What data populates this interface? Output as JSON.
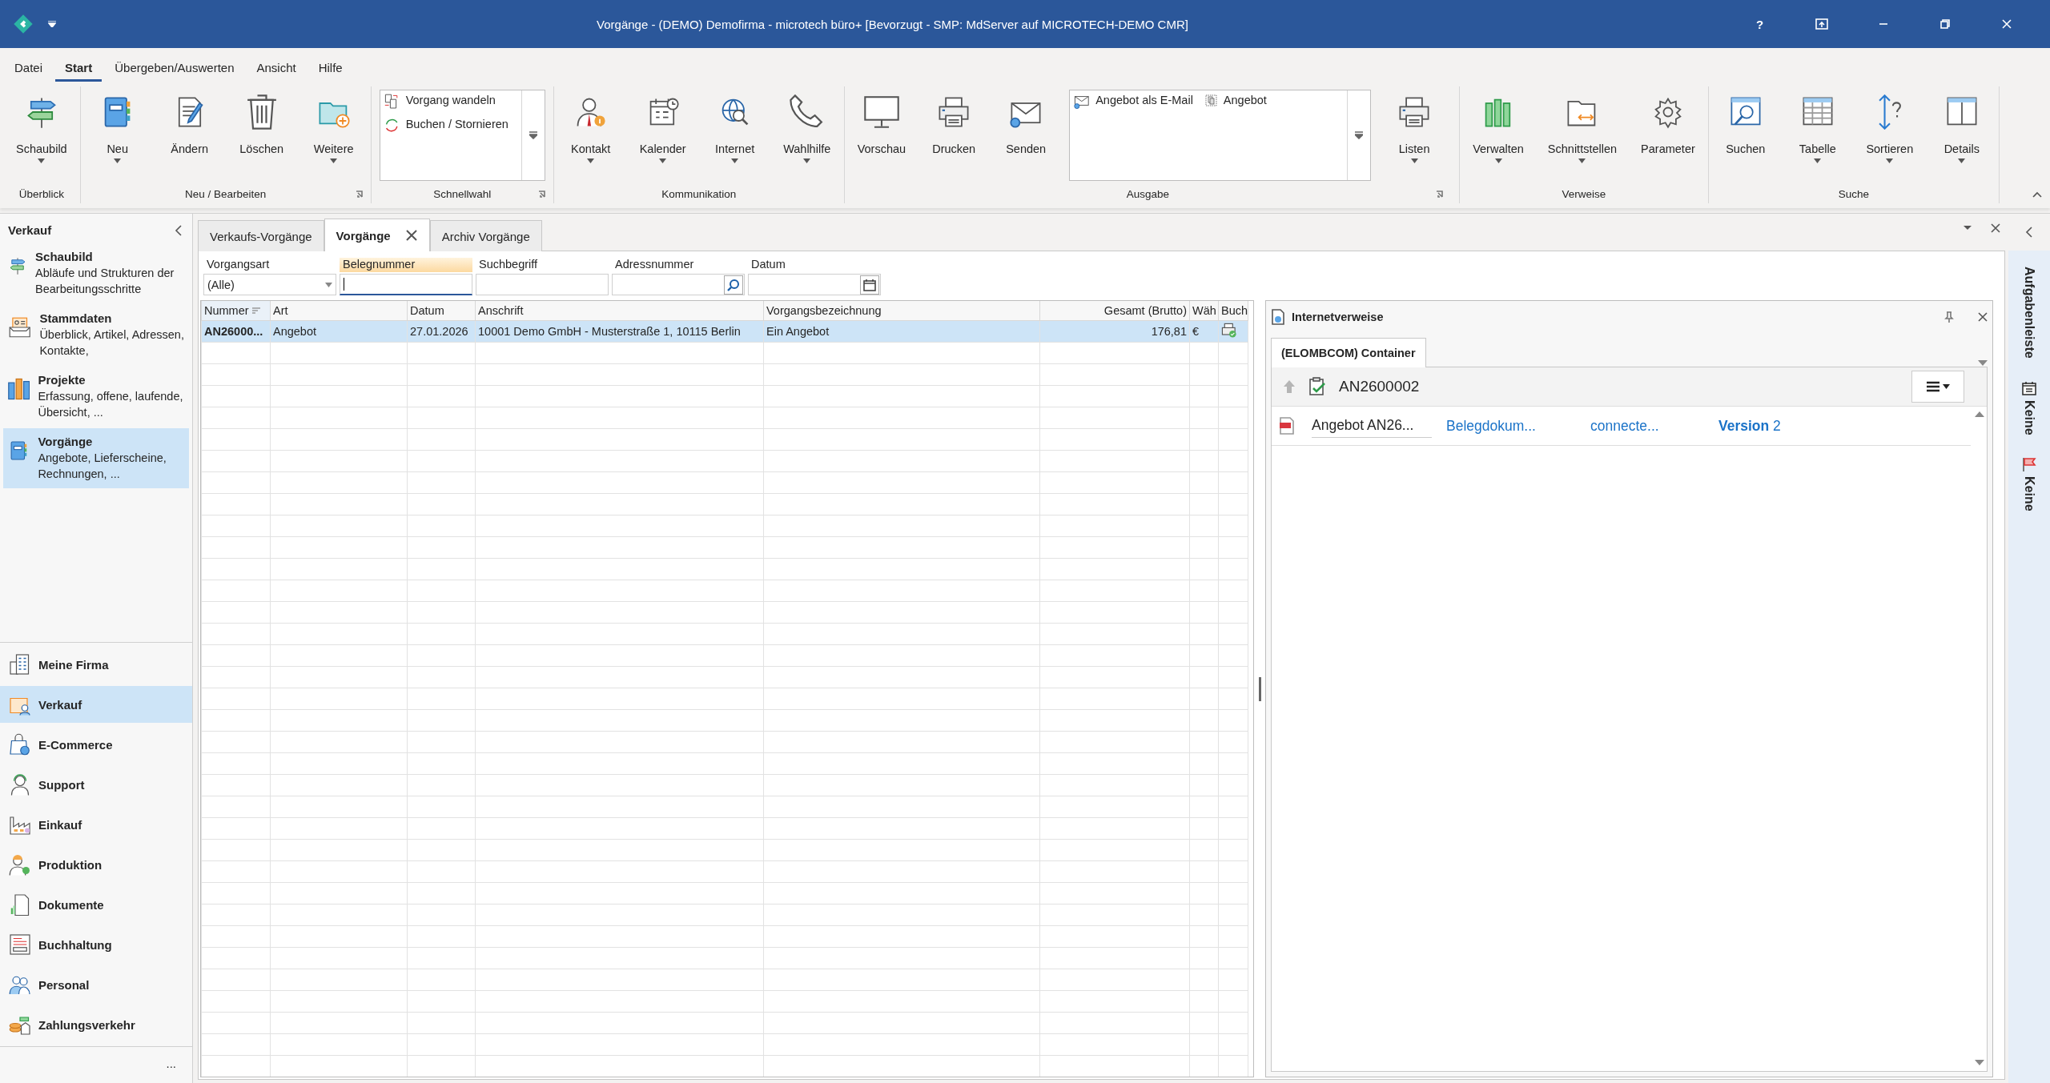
{
  "window": {
    "title": "Vorgänge - (DEMO) Demofirma - microtech büro+ [Bevorzugt - SMP: MdServer auf MICROTECH-DEMO CMR]",
    "help": "?"
  },
  "menu_tabs": [
    {
      "label": "Datei",
      "selected": false
    },
    {
      "label": "Start",
      "selected": true
    },
    {
      "label": "Übergeben/Auswerten",
      "selected": false
    },
    {
      "label": "Ansicht",
      "selected": false
    },
    {
      "label": "Hilfe",
      "selected": false
    }
  ],
  "ribbon": {
    "groups": [
      {
        "label": "Überblick",
        "launcher": false,
        "items": [
          {
            "kind": "large",
            "label": "Schaubild",
            "dropdown": true
          }
        ]
      },
      {
        "label": "Neu / Bearbeiten",
        "launcher": true,
        "items": [
          {
            "kind": "large",
            "label": "Neu",
            "dropdown": true
          },
          {
            "kind": "large",
            "label": "Ändern",
            "dropdown": false
          },
          {
            "kind": "large",
            "label": "Löschen",
            "dropdown": false
          },
          {
            "kind": "large",
            "label": "Weitere",
            "dropdown": true
          }
        ]
      },
      {
        "label": "Schnellwahl",
        "launcher": true,
        "items": [
          {
            "kind": "gallery",
            "entries": [
              "Vorgang wandeln",
              "Buchen / Stornieren"
            ]
          }
        ]
      },
      {
        "label": "Kommunikation",
        "launcher": false,
        "items": [
          {
            "kind": "large",
            "label": "Kontakt",
            "dropdown": true
          },
          {
            "kind": "large",
            "label": "Kalender",
            "dropdown": true
          },
          {
            "kind": "large",
            "label": "Internet",
            "dropdown": true
          },
          {
            "kind": "large",
            "label": "Wahlhilfe",
            "dropdown": true
          }
        ]
      },
      {
        "label": "Ausgabe",
        "launcher": true,
        "items": [
          {
            "kind": "large",
            "label": "Vorschau",
            "dropdown": false
          },
          {
            "kind": "large",
            "label": "Drucken",
            "dropdown": false
          },
          {
            "kind": "large",
            "label": "Senden",
            "dropdown": false
          },
          {
            "kind": "gallery",
            "entries": [
              "Angebot als E-Mail",
              "Angebot"
            ]
          },
          {
            "kind": "large",
            "label": "Listen",
            "dropdown": true
          }
        ]
      },
      {
        "label": "Verweise",
        "launcher": false,
        "items": [
          {
            "kind": "large",
            "label": "Verwalten",
            "dropdown": true
          },
          {
            "kind": "large",
            "label": "Schnittstellen",
            "dropdown": true
          },
          {
            "kind": "large",
            "label": "Parameter",
            "dropdown": false
          }
        ]
      },
      {
        "label": "Suche",
        "launcher": false,
        "items": [
          {
            "kind": "large",
            "label": "Suchen",
            "dropdown": false
          },
          {
            "kind": "large",
            "label": "Tabelle",
            "dropdown": true
          },
          {
            "kind": "large",
            "label": "Sortieren",
            "dropdown": true
          },
          {
            "kind": "large",
            "label": "Details",
            "dropdown": true
          }
        ]
      }
    ]
  },
  "sidebar": {
    "title": "Verkauf",
    "modules": [
      {
        "title": "Schaubild",
        "description": "Abläufe und Strukturen der Bearbeitungsschritte",
        "selected": false
      },
      {
        "title": "Stammdaten",
        "description": "Überblick, Artikel, Adressen, Kontakte,",
        "selected": false
      },
      {
        "title": "Projekte",
        "description": "Erfassung, offene, laufende, Übersicht, ...",
        "selected": false
      },
      {
        "title": "Vorgänge",
        "description": "Angebote, Lieferscheine, Rechnungen, ...",
        "selected": true
      }
    ],
    "sections": [
      {
        "label": "Meine Firma",
        "selected": false
      },
      {
        "label": "Verkauf",
        "selected": true
      },
      {
        "label": "E-Commerce",
        "selected": false
      },
      {
        "label": "Support",
        "selected": false
      },
      {
        "label": "Einkauf",
        "selected": false
      },
      {
        "label": "Produktion",
        "selected": false
      },
      {
        "label": "Dokumente",
        "selected": false
      },
      {
        "label": "Buchhaltung",
        "selected": false
      },
      {
        "label": "Personal",
        "selected": false
      },
      {
        "label": "Zahlungsverkehr",
        "selected": false
      }
    ],
    "more": "..."
  },
  "doc_tabs": [
    {
      "label": "Verkaufs-Vorgänge",
      "selected": false,
      "closable": false
    },
    {
      "label": "Vorgänge",
      "selected": true,
      "closable": true
    },
    {
      "label": "Archiv Vorgänge",
      "selected": false,
      "closable": false
    }
  ],
  "filters": [
    {
      "kind": "select",
      "label": "Vorgangsart",
      "value": "(Alle)",
      "focused": false
    },
    {
      "kind": "text",
      "label": "Belegnummer",
      "focused": true
    },
    {
      "kind": "text",
      "label": "Suchbegriff",
      "focused": false
    },
    {
      "kind": "search",
      "label": "Adressnummer",
      "focused": false
    },
    {
      "kind": "date",
      "label": "Datum",
      "focused": false
    }
  ],
  "table": {
    "columns": [
      {
        "label": "Nummer",
        "sorted": true
      },
      {
        "label": "Art",
        "sorted": false
      },
      {
        "label": "Datum",
        "sorted": false
      },
      {
        "label": "Anschrift",
        "sorted": false
      },
      {
        "label": "Vorgangsbezeichnung",
        "sorted": false
      },
      {
        "label": "Gesamt (Brutto)",
        "sorted": false
      },
      {
        "label": "Wäh",
        "sorted": false
      },
      {
        "label": "Buch",
        "sorted": false
      }
    ],
    "rows": [
      {
        "cells": [
          "AN26000...",
          "Angebot",
          "27.01.2026",
          "10001  Demo GmbH - Musterstraße 1, 10115 Berlin",
          "Ein Angebot",
          "176,81",
          "€"
        ],
        "booked": true,
        "selected": true
      }
    ]
  },
  "panel": {
    "title": "Internetverweise",
    "tabs": [
      {
        "label": "(ELOMBCOM) Container",
        "selected": true
      }
    ],
    "path": "AN2600002",
    "documents": [
      {
        "name": "Angebot AN26...",
        "type": "Belegdokum...",
        "status": "connecte...",
        "version": "**Version** 2"
      }
    ]
  },
  "taskbar": {
    "title": "Aufgabenleiste",
    "items": [
      {
        "label": "Keine"
      },
      {
        "label": "Keine"
      }
    ]
  }
}
